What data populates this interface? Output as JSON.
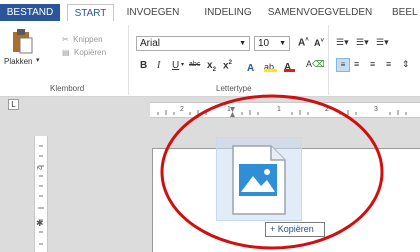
{
  "tabs": {
    "bestand": "BESTAND",
    "start": "START",
    "invoegen": "INVOEGEN",
    "indeling": "INDELING",
    "samenvoegvelden": "SAMENVOEGVELDEN",
    "beeld": "BEEL"
  },
  "clipboard": {
    "plakken_label": "Plakken",
    "knippen_label": "Knippen",
    "kopieren_label": "Kopiëren",
    "group_label": "Klembord"
  },
  "font": {
    "font_name": "Arial",
    "font_size": "10",
    "group_label": "Lettertype"
  },
  "drag": {
    "tooltip_label": "+ Kopiëren"
  },
  "colors": {
    "accent": "#2b579a",
    "highlight_yellow": "#ffe900",
    "font_red": "#d9201c",
    "annotation_red": "#d01010",
    "image_blue": "#2f8fd6"
  }
}
